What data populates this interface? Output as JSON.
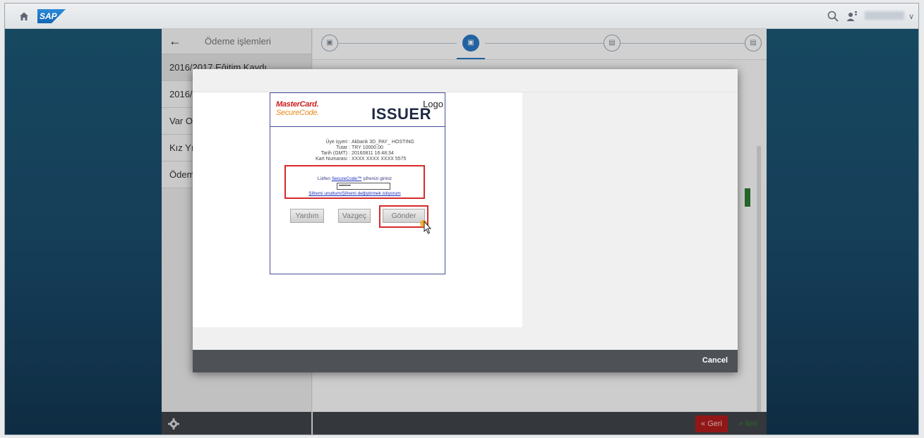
{
  "sidebar": {
    "title": "Ödeme işlemleri",
    "items": [
      {
        "label": "2016/2017 Eğitim Kaydı"
      },
      {
        "label": "2016/"
      },
      {
        "label": "Var O"
      },
      {
        "label": "Kız Yı"
      },
      {
        "label": "Ödem"
      }
    ]
  },
  "stepper": {
    "step_icons": [
      "cart-icon",
      "card-icon",
      "document-icon",
      "receipt-icon"
    ],
    "active_step": 2
  },
  "footer": {
    "back_label": "Geri",
    "next_label": "İleri"
  },
  "dialog": {
    "cancel_label": "Cancel"
  },
  "secure": {
    "brand_line1": "MasterCard.",
    "brand_line2": "SecureCode.",
    "issuer_logo": "Logo",
    "issuer_name": "ISSUER",
    "info": [
      {
        "key": "Üye işyeri :",
        "value": "Akbank 3D_PAY_ HOSTING"
      },
      {
        "key": "Tutar :",
        "value": "TRY 10000.00"
      },
      {
        "key": "Tarih (GMT) :",
        "value": "20160811 16:48:34"
      },
      {
        "key": "Kart Numarası :",
        "value": "XXXX XXXX XXXX 5575"
      }
    ],
    "prompt_prefix": "Lütfen ",
    "prompt_link": "SecureCode™",
    "prompt_suffix": " şifrenizi giriniz",
    "password_value": "••••••••",
    "forgot_link": "Şifremi unuttum/Şifremi değiştirmek istiyorum",
    "help_label": "Yardım",
    "cancel_label": "Vazgeç",
    "submit_label": "Gönder"
  },
  "colors": {
    "shell_bg": "#1c5a78",
    "primary": "#2a78c5",
    "danger": "#b11d1d",
    "highlight": "#d62a2a"
  }
}
